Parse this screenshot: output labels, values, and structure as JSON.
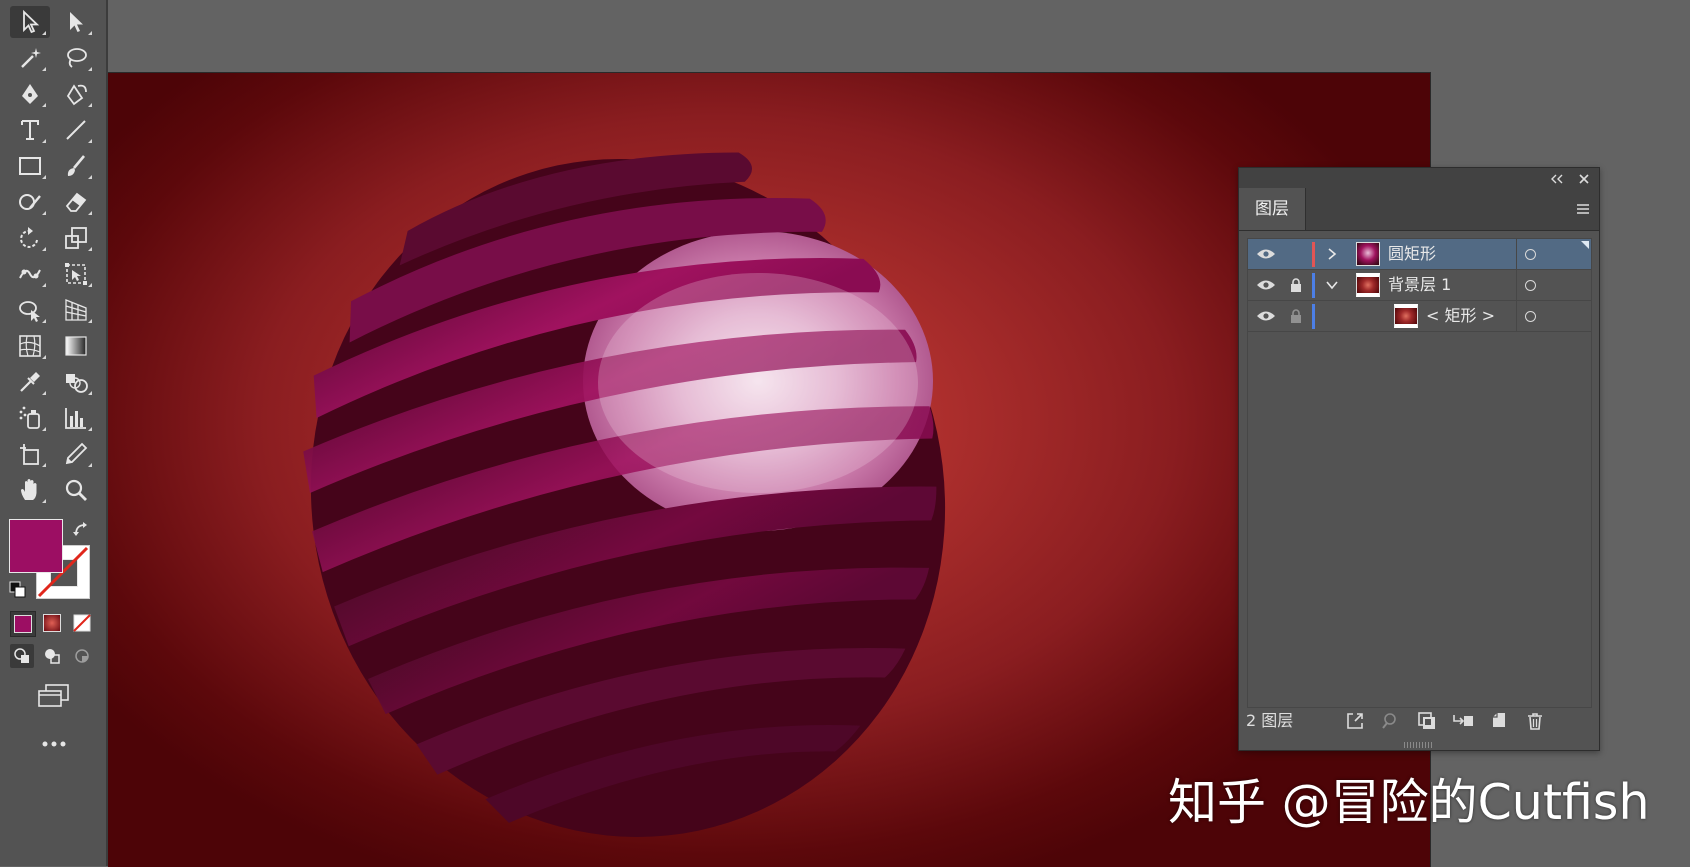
{
  "layers_panel": {
    "tab_label": "图层",
    "layers": [
      {
        "name": "圆矩形",
        "visible": true,
        "locked": false,
        "expanded": false,
        "selected": true,
        "color": "#e25555"
      },
      {
        "name": "背景层 1",
        "visible": true,
        "locked": true,
        "expanded": true,
        "selected": false,
        "color": "#4c7fe6"
      },
      {
        "name": "< 矩形 >",
        "visible": true,
        "locked": true,
        "selected": false,
        "color": "#4c7fe6"
      }
    ],
    "footer_count": "2 图层"
  },
  "colors": {
    "fill": "#9c0e63",
    "artboard_center": "#c8493c",
    "artboard_edge": "#4d0407",
    "panel_selection": "#526a84"
  },
  "watermark": "知乎 @冒险的Cutfish"
}
